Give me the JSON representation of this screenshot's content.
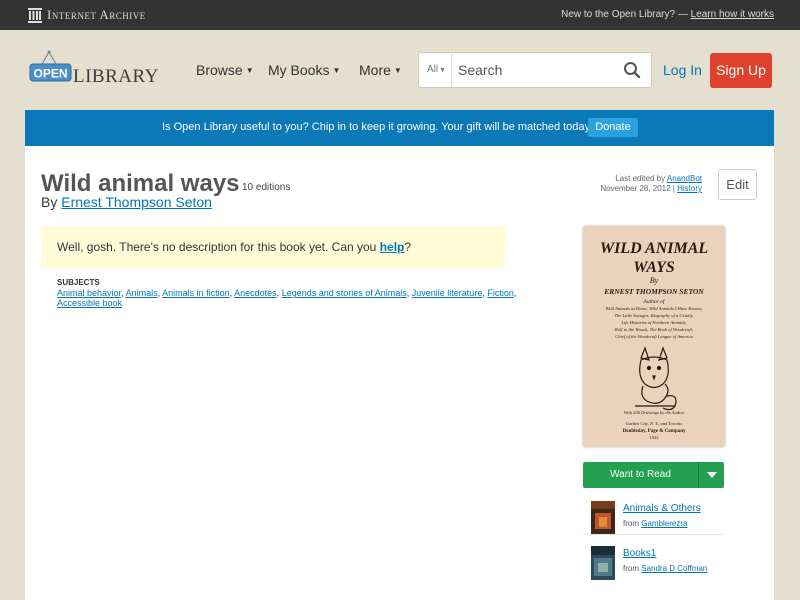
{
  "ia_bar": {
    "logo_text": "Internet Archive",
    "new_text": "New to the Open Library? —",
    "learn_link": "Learn how it works"
  },
  "header": {
    "logo_open": "OPEN",
    "logo_library": "LIBRARY",
    "nav": {
      "browse": "Browse",
      "mybooks": "My Books",
      "more": "More"
    },
    "search": {
      "scope": "All",
      "placeholder": "Search"
    },
    "login": "Log In",
    "signup": "Sign Up"
  },
  "banner": {
    "text": "Is Open Library useful to you? Chip in to keep it growing. Your gift will be matched today!",
    "button": "Donate",
    "background": "#0b78b8"
  },
  "book": {
    "title": "Wild animal ways",
    "editions": "10 editions",
    "by": "By",
    "author": "Ernest Thompson Seton",
    "last_edited_by": "Last edited by",
    "editor": "AnandBot",
    "edit_date": "November 28, 2012",
    "history": "History",
    "edit_button": "Edit",
    "description_text": "Well, gosh. There's no description for this book yet. Can you",
    "help_link": "help",
    "description_end": "?",
    "subjects_heading": "SUBJECTS",
    "subjects": [
      "Animal behavior",
      "Animals",
      "Animals in fiction",
      "Anecdotes",
      "Legends and stories of Animals",
      "Juvenile literature",
      "Fiction",
      "Accessible book"
    ]
  },
  "cover": {
    "title_line1": "WILD ANIMAL",
    "title_line2": "WAYS",
    "by": "By",
    "author": "ERNEST THOMPSON SETON",
    "author_of": "Author of",
    "works": [
      "Wild Animals at Home, Wild Animals I Have Known,",
      "The Little Savages, Biography of a Grizzly,",
      "Life Histories of Northern Animals,",
      "Rolf in the Woods, The Book of Woodcraft,",
      "Chief of the Woodcraft League of America"
    ],
    "drawings": "With 200 Drawings by the Author",
    "place": "Garden City, N. Y., and Toronto",
    "publisher": "Doubleday, Page & Company",
    "year": "1922"
  },
  "actions": {
    "want_to_read": "Want to Read",
    "color": "#23a050"
  },
  "lists": [
    {
      "title": "Animals & Others",
      "from_label": "from",
      "author": "Gamblerezra"
    },
    {
      "title": "Books1",
      "from_label": "from",
      "author": "Sandra D Coffman"
    }
  ]
}
